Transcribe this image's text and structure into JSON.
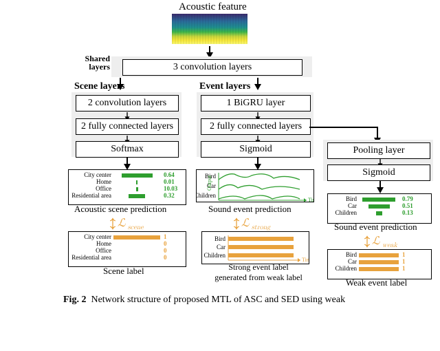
{
  "header": {
    "title": "Acoustic feature"
  },
  "shared": {
    "label": "Shared\nlayers",
    "box": "3 convolution layers"
  },
  "scene": {
    "section": "Scene layers",
    "boxes": [
      "2 convolution layers",
      "2 fully connected layers",
      "Softmax"
    ],
    "pred_caption": "Acoustic scene prediction",
    "label_caption": "Scene label",
    "loss": "ℒ scene",
    "categories": [
      "City center",
      "Home",
      "Office",
      "Residential area"
    ],
    "pred_values": [
      0.64,
      0.01,
      10.03,
      0.32
    ],
    "label_values": [
      1.0,
      0.0,
      0.0,
      0.0
    ]
  },
  "event": {
    "section": "Event layers",
    "boxes": [
      "1 BiGRU layer",
      "2 fully connected layers",
      "Sigmoid"
    ],
    "pool_boxes": [
      "Pooling layer",
      "Sigmoid"
    ],
    "categories": [
      "Bird",
      "Car",
      "Children"
    ],
    "strong_caption": "Sound event prediction",
    "strong_label_caption": "Strong event label generated from weak label",
    "weak_pred_caption": "Sound event prediction",
    "weak_label_caption": "Weak event label",
    "loss_strong": "ℒ strong",
    "loss_weak": "ℒ weak",
    "weak_pred_values": [
      0.79,
      0.51,
      0.13
    ],
    "weak_label_values": [
      1.0,
      1.0,
      1.0
    ],
    "time_label": "Time",
    "output_label": "Output"
  },
  "figure_caption": "Fig. 2  Network structure of proposed MTL of ASC and SED using weak"
}
